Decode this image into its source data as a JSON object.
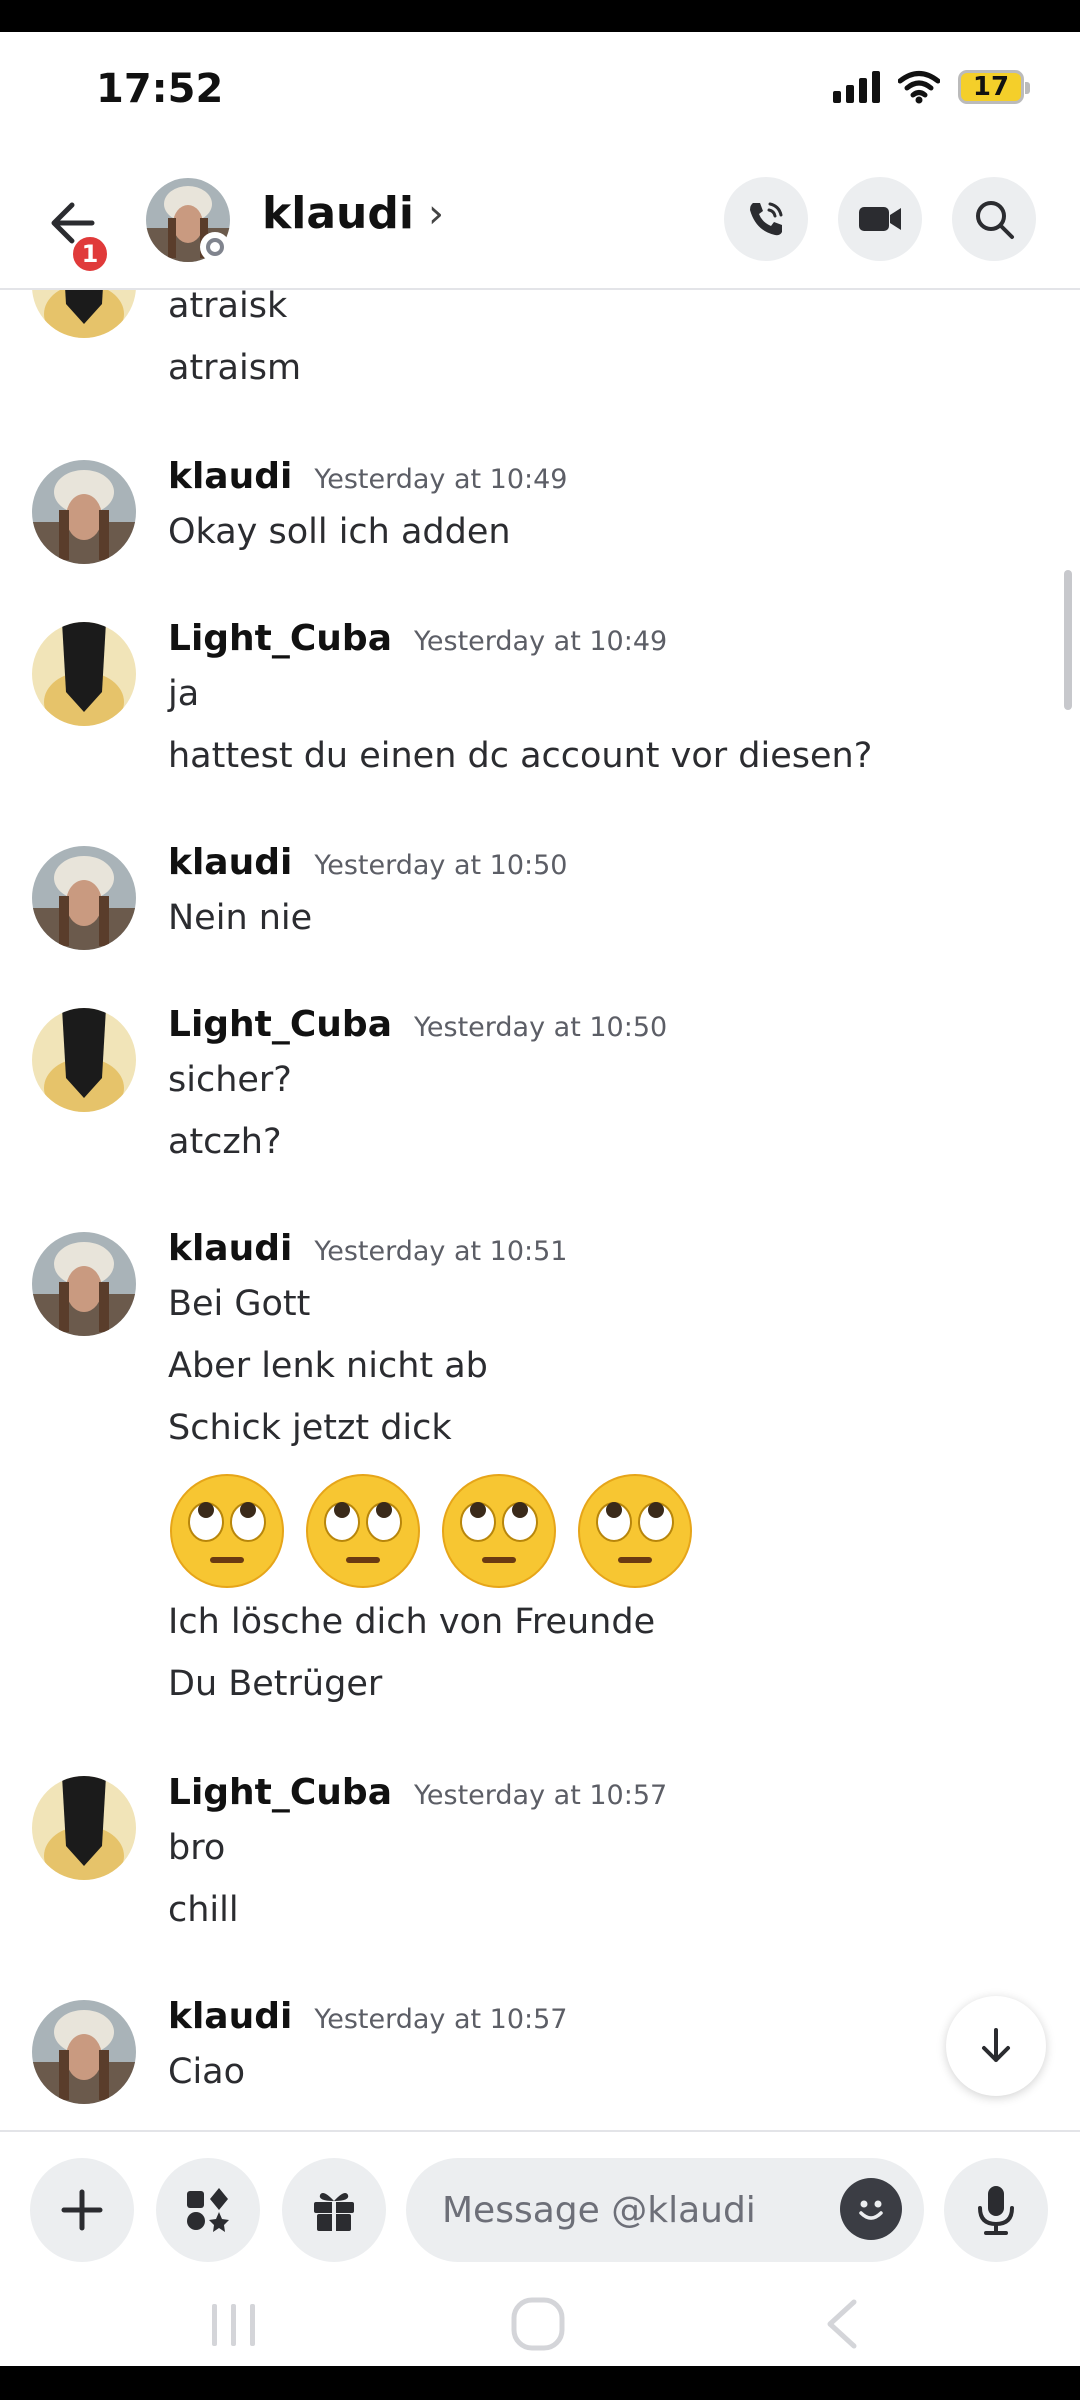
{
  "status_bar": {
    "time": "17:52",
    "battery": "17"
  },
  "header": {
    "back_badge": "1",
    "contact_name": "klaudi",
    "chevron": "›",
    "icons": [
      "back-arrow-icon",
      "phone-call-icon",
      "video-camera-icon",
      "search-icon"
    ]
  },
  "messages": {
    "partial": {
      "lines": [
        "atraisk",
        "atraism"
      ]
    },
    "groups": [
      {
        "author": "klaudi",
        "time": "Yesterday at 10:49",
        "lines": [
          "Okay soll ich adden"
        ]
      },
      {
        "author": "Light_Cuba",
        "time": "Yesterday at 10:49",
        "lines": [
          "ja",
          "hattest du einen dc account vor diesen?"
        ]
      },
      {
        "author": "klaudi",
        "time": "Yesterday at 10:50",
        "lines": [
          "Nein nie"
        ]
      },
      {
        "author": "Light_Cuba",
        "time": "Yesterday at 10:50",
        "lines": [
          "sicher?",
          "atczh?"
        ]
      },
      {
        "author": "klaudi",
        "time": "Yesterday at 10:51",
        "lines": [
          "Bei Gott",
          "Aber lenk nicht ab",
          "Schick jetzt dick",
          "Ich lösche dich von Freunde",
          "Du Betrüger"
        ],
        "emojis": [
          "face-with-rolling-eyes",
          "face-with-rolling-eyes",
          "face-with-rolling-eyes",
          "face-with-rolling-eyes"
        ]
      },
      {
        "author": "Light_Cuba",
        "time": "Yesterday at 10:57",
        "lines": [
          "bro",
          "chill"
        ]
      },
      {
        "author": "klaudi",
        "time": "Yesterday at 10:57",
        "lines": [
          "Ciao"
        ]
      }
    ]
  },
  "composer": {
    "placeholder": "Message @klaudi",
    "icons": [
      "plus-icon",
      "apps-icon",
      "gift-icon",
      "emoji-icon",
      "microphone-icon"
    ]
  },
  "colors": {
    "accent_red": "#e03a3a",
    "button_bg": "#eceef0",
    "battery_yellow": "#f4cf2a"
  }
}
